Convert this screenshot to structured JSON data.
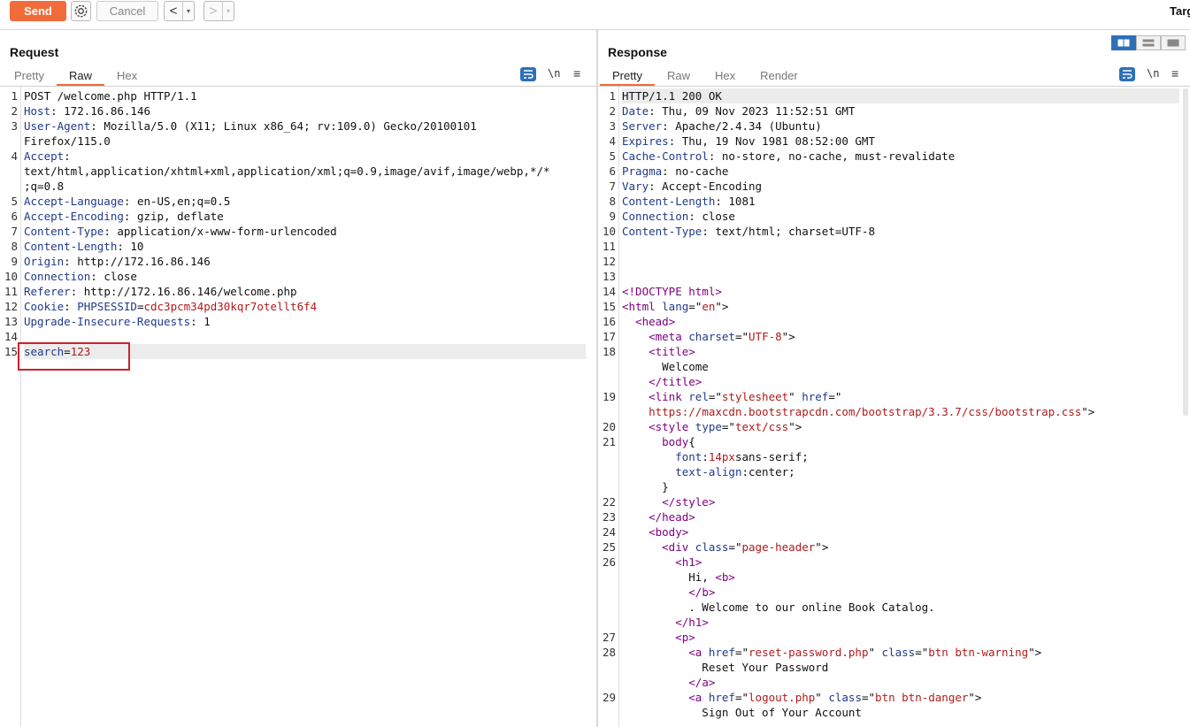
{
  "toolbar": {
    "send_label": "Send",
    "cancel_label": "Cancel",
    "back_arrow": "<",
    "forward_arrow": ">",
    "drop_glyph": "▾",
    "target_label": "Targ"
  },
  "request": {
    "title": "Request",
    "tabs": [
      "Pretty",
      "Raw",
      "Hex"
    ],
    "active_tab": "Raw",
    "newline_icon": "\\n",
    "menu_icon": "≡",
    "lines": [
      {
        "num": "1",
        "parts": [
          {
            "t": "POST /welcome.php HTTP/1.1",
            "c": ""
          }
        ]
      },
      {
        "num": "2",
        "parts": [
          {
            "t": "Host",
            "c": "hk"
          },
          {
            "t": ": 172.16.86.146",
            "c": ""
          }
        ]
      },
      {
        "num": "3",
        "parts": [
          {
            "t": "User-Agent",
            "c": "hk"
          },
          {
            "t": ": Mozilla/5.0 (X11; Linux x86_64; rv:109.0) Gecko/20100101",
            "c": ""
          }
        ]
      },
      {
        "num": "",
        "parts": [
          {
            "t": "Firefox/115.0",
            "c": ""
          }
        ]
      },
      {
        "num": "4",
        "parts": [
          {
            "t": "Accept",
            "c": "hk"
          },
          {
            "t": ":",
            "c": ""
          }
        ]
      },
      {
        "num": "",
        "parts": [
          {
            "t": "text/html,application/xhtml+xml,application/xml;q=0.9,image/avif,image/webp,*/*",
            "c": ""
          }
        ]
      },
      {
        "num": "",
        "parts": [
          {
            "t": ";q=0.8",
            "c": ""
          }
        ]
      },
      {
        "num": "5",
        "parts": [
          {
            "t": "Accept-Language",
            "c": "hk"
          },
          {
            "t": ": en-US,en;q=0.5",
            "c": ""
          }
        ]
      },
      {
        "num": "6",
        "parts": [
          {
            "t": "Accept-Encoding",
            "c": "hk"
          },
          {
            "t": ": gzip, deflate",
            "c": ""
          }
        ]
      },
      {
        "num": "7",
        "parts": [
          {
            "t": "Content-Type",
            "c": "hk"
          },
          {
            "t": ": application/x-www-form-urlencoded",
            "c": ""
          }
        ]
      },
      {
        "num": "8",
        "parts": [
          {
            "t": "Content-Length",
            "c": "hk"
          },
          {
            "t": ": 10",
            "c": ""
          }
        ]
      },
      {
        "num": "9",
        "parts": [
          {
            "t": "Origin",
            "c": "hk"
          },
          {
            "t": ": http://172.16.86.146",
            "c": ""
          }
        ]
      },
      {
        "num": "10",
        "parts": [
          {
            "t": "Connection",
            "c": "hk"
          },
          {
            "t": ": close",
            "c": ""
          }
        ]
      },
      {
        "num": "11",
        "parts": [
          {
            "t": "Referer",
            "c": "hk"
          },
          {
            "t": ": http://172.16.86.146/welcome.php",
            "c": ""
          }
        ]
      },
      {
        "num": "12",
        "parts": [
          {
            "t": "Cookie",
            "c": "hk"
          },
          {
            "t": ": ",
            "c": ""
          },
          {
            "t": "PHPSESSID",
            "c": "blue"
          },
          {
            "t": "=",
            "c": ""
          },
          {
            "t": "cdc3pcm34pd30kqr7otellt6f4",
            "c": "red"
          }
        ]
      },
      {
        "num": "13",
        "parts": [
          {
            "t": "Upgrade-Insecure-Requests",
            "c": "hk"
          },
          {
            "t": ": 1",
            "c": ""
          }
        ]
      },
      {
        "num": "14",
        "parts": []
      },
      {
        "num": "15",
        "parts": [
          {
            "t": "search",
            "c": "blue"
          },
          {
            "t": "=",
            "c": ""
          },
          {
            "t": "123",
            "c": "red"
          }
        ]
      }
    ]
  },
  "response": {
    "title": "Response",
    "tabs": [
      "Pretty",
      "Raw",
      "Hex",
      "Render"
    ],
    "active_tab": "Pretty",
    "newline_icon": "\\n",
    "menu_icon": "≡",
    "lines": [
      {
        "num": "1",
        "parts": [
          {
            "t": "HTTP/1.1 200 OK",
            "c": ""
          }
        ]
      },
      {
        "num": "2",
        "parts": [
          {
            "t": "Date",
            "c": "hk"
          },
          {
            "t": ": Thu, 09 Nov 2023 11:52:51 GMT",
            "c": ""
          }
        ]
      },
      {
        "num": "3",
        "parts": [
          {
            "t": "Server",
            "c": "hk"
          },
          {
            "t": ": Apache/2.4.34 (Ubuntu)",
            "c": ""
          }
        ]
      },
      {
        "num": "4",
        "parts": [
          {
            "t": "Expires",
            "c": "hk"
          },
          {
            "t": ": Thu, 19 Nov 1981 08:52:00 GMT",
            "c": ""
          }
        ]
      },
      {
        "num": "5",
        "parts": [
          {
            "t": "Cache-Control",
            "c": "hk"
          },
          {
            "t": ": no-store, no-cache, must-revalidate",
            "c": ""
          }
        ]
      },
      {
        "num": "6",
        "parts": [
          {
            "t": "Pragma",
            "c": "hk"
          },
          {
            "t": ": no-cache",
            "c": ""
          }
        ]
      },
      {
        "num": "7",
        "parts": [
          {
            "t": "Vary",
            "c": "hk"
          },
          {
            "t": ": Accept-Encoding",
            "c": ""
          }
        ]
      },
      {
        "num": "8",
        "parts": [
          {
            "t": "Content-Length",
            "c": "hk"
          },
          {
            "t": ": 1081",
            "c": ""
          }
        ]
      },
      {
        "num": "9",
        "parts": [
          {
            "t": "Connection",
            "c": "hk"
          },
          {
            "t": ": close",
            "c": ""
          }
        ]
      },
      {
        "num": "10",
        "parts": [
          {
            "t": "Content-Type",
            "c": "hk"
          },
          {
            "t": ": text/html; charset=UTF-8",
            "c": ""
          }
        ]
      },
      {
        "num": "11",
        "parts": []
      },
      {
        "num": "12",
        "parts": []
      },
      {
        "num": "13",
        "parts": []
      },
      {
        "num": "14",
        "parts": [
          {
            "t": "<!DOCTYPE html>",
            "c": "tag"
          }
        ]
      },
      {
        "num": "15",
        "parts": [
          {
            "t": "<html ",
            "c": "tag"
          },
          {
            "t": "lang",
            "c": "attr"
          },
          {
            "t": "=\"",
            "c": ""
          },
          {
            "t": "en",
            "c": "str"
          },
          {
            "t": "\">",
            "c": ""
          }
        ]
      },
      {
        "num": "16",
        "parts": [
          {
            "t": "  ",
            "c": ""
          },
          {
            "t": "<head>",
            "c": "tag"
          }
        ]
      },
      {
        "num": "17",
        "parts": [
          {
            "t": "    ",
            "c": ""
          },
          {
            "t": "<meta ",
            "c": "tag"
          },
          {
            "t": "charset",
            "c": "attr"
          },
          {
            "t": "=\"",
            "c": ""
          },
          {
            "t": "UTF-8",
            "c": "str"
          },
          {
            "t": "\">",
            "c": ""
          }
        ]
      },
      {
        "num": "18",
        "parts": [
          {
            "t": "    ",
            "c": ""
          },
          {
            "t": "<title>",
            "c": "tag"
          }
        ]
      },
      {
        "num": "",
        "parts": [
          {
            "t": "      Welcome",
            "c": ""
          }
        ]
      },
      {
        "num": "",
        "parts": [
          {
            "t": "    ",
            "c": ""
          },
          {
            "t": "</title>",
            "c": "tag"
          }
        ]
      },
      {
        "num": "19",
        "parts": [
          {
            "t": "    ",
            "c": ""
          },
          {
            "t": "<link ",
            "c": "tag"
          },
          {
            "t": "rel",
            "c": "attr"
          },
          {
            "t": "=\"",
            "c": ""
          },
          {
            "t": "stylesheet",
            "c": "str"
          },
          {
            "t": "\" ",
            "c": ""
          },
          {
            "t": "href",
            "c": "attr"
          },
          {
            "t": "=\"",
            "c": ""
          }
        ]
      },
      {
        "num": "",
        "parts": [
          {
            "t": "    ",
            "c": ""
          },
          {
            "t": "https://maxcdn.bootstrapcdn.com/bootstrap/3.3.7/css/bootstrap.css",
            "c": "str"
          },
          {
            "t": "\">",
            "c": ""
          }
        ]
      },
      {
        "num": "20",
        "parts": [
          {
            "t": "    ",
            "c": ""
          },
          {
            "t": "<style ",
            "c": "tag"
          },
          {
            "t": "type",
            "c": "attr"
          },
          {
            "t": "=\"",
            "c": ""
          },
          {
            "t": "text/css",
            "c": "str"
          },
          {
            "t": "\">",
            "c": ""
          }
        ]
      },
      {
        "num": "21",
        "parts": [
          {
            "t": "      ",
            "c": ""
          },
          {
            "t": "body",
            "c": "tag"
          },
          {
            "t": "{",
            "c": ""
          }
        ]
      },
      {
        "num": "",
        "parts": [
          {
            "t": "        ",
            "c": ""
          },
          {
            "t": "font",
            "c": "attr"
          },
          {
            "t": ":",
            "c": ""
          },
          {
            "t": "14px",
            "c": "str"
          },
          {
            "t": "sans-serif;",
            "c": ""
          }
        ]
      },
      {
        "num": "",
        "parts": [
          {
            "t": "        ",
            "c": ""
          },
          {
            "t": "text-align",
            "c": "attr"
          },
          {
            "t": ":center;",
            "c": ""
          }
        ]
      },
      {
        "num": "",
        "parts": [
          {
            "t": "      }",
            "c": ""
          }
        ]
      },
      {
        "num": "22",
        "parts": [
          {
            "t": "      ",
            "c": ""
          },
          {
            "t": "</style>",
            "c": "tag"
          }
        ]
      },
      {
        "num": "23",
        "parts": [
          {
            "t": "    ",
            "c": ""
          },
          {
            "t": "</head>",
            "c": "tag"
          }
        ]
      },
      {
        "num": "24",
        "parts": [
          {
            "t": "    ",
            "c": ""
          },
          {
            "t": "<body>",
            "c": "tag"
          }
        ]
      },
      {
        "num": "25",
        "parts": [
          {
            "t": "      ",
            "c": ""
          },
          {
            "t": "<div ",
            "c": "tag"
          },
          {
            "t": "class",
            "c": "attr"
          },
          {
            "t": "=\"",
            "c": ""
          },
          {
            "t": "page-header",
            "c": "str"
          },
          {
            "t": "\">",
            "c": ""
          }
        ]
      },
      {
        "num": "26",
        "parts": [
          {
            "t": "        ",
            "c": ""
          },
          {
            "t": "<h1>",
            "c": "tag"
          }
        ]
      },
      {
        "num": "",
        "parts": [
          {
            "t": "          Hi, ",
            "c": ""
          },
          {
            "t": "<b>",
            "c": "tag"
          }
        ]
      },
      {
        "num": "",
        "parts": [
          {
            "t": "          ",
            "c": ""
          },
          {
            "t": "</b>",
            "c": "tag"
          }
        ]
      },
      {
        "num": "",
        "parts": [
          {
            "t": "          . Welcome to our online Book Catalog.",
            "c": ""
          }
        ]
      },
      {
        "num": "",
        "parts": [
          {
            "t": "        ",
            "c": ""
          },
          {
            "t": "</h1>",
            "c": "tag"
          }
        ]
      },
      {
        "num": "27",
        "parts": [
          {
            "t": "        ",
            "c": ""
          },
          {
            "t": "<p>",
            "c": "tag"
          }
        ]
      },
      {
        "num": "28",
        "parts": [
          {
            "t": "          ",
            "c": ""
          },
          {
            "t": "<a ",
            "c": "tag"
          },
          {
            "t": "href",
            "c": "attr"
          },
          {
            "t": "=\"",
            "c": ""
          },
          {
            "t": "reset-password.php",
            "c": "str"
          },
          {
            "t": "\" ",
            "c": ""
          },
          {
            "t": "class",
            "c": "attr"
          },
          {
            "t": "=\"",
            "c": ""
          },
          {
            "t": "btn btn-warning",
            "c": "str"
          },
          {
            "t": "\">",
            "c": ""
          }
        ]
      },
      {
        "num": "",
        "parts": [
          {
            "t": "            Reset Your Password",
            "c": ""
          }
        ]
      },
      {
        "num": "",
        "parts": [
          {
            "t": "          ",
            "c": ""
          },
          {
            "t": "</a>",
            "c": "tag"
          }
        ]
      },
      {
        "num": "29",
        "parts": [
          {
            "t": "          ",
            "c": ""
          },
          {
            "t": "<a ",
            "c": "tag"
          },
          {
            "t": "href",
            "c": "attr"
          },
          {
            "t": "=\"",
            "c": ""
          },
          {
            "t": "logout.php",
            "c": "str"
          },
          {
            "t": "\" ",
            "c": ""
          },
          {
            "t": "class",
            "c": "attr"
          },
          {
            "t": "=\"",
            "c": ""
          },
          {
            "t": "btn btn-danger",
            "c": "str"
          },
          {
            "t": "\">",
            "c": ""
          }
        ]
      },
      {
        "num": "",
        "parts": [
          {
            "t": "            Sign Out of Your Account",
            "c": ""
          }
        ]
      }
    ]
  },
  "colors": {
    "accent": "#f26b3a",
    "highlight_box": "#d0202a",
    "header_key": "#1f3a8a",
    "tag": "#800080",
    "string": "#b01b1b"
  },
  "icons": {
    "settings": "gear-icon",
    "wrap": "word-wrap-icon",
    "newline": "newline-icon",
    "menu": "hamburger-menu-icon",
    "layout": [
      "split-horizontal-icon",
      "split-vertical-icon",
      "single-pane-icon"
    ]
  }
}
